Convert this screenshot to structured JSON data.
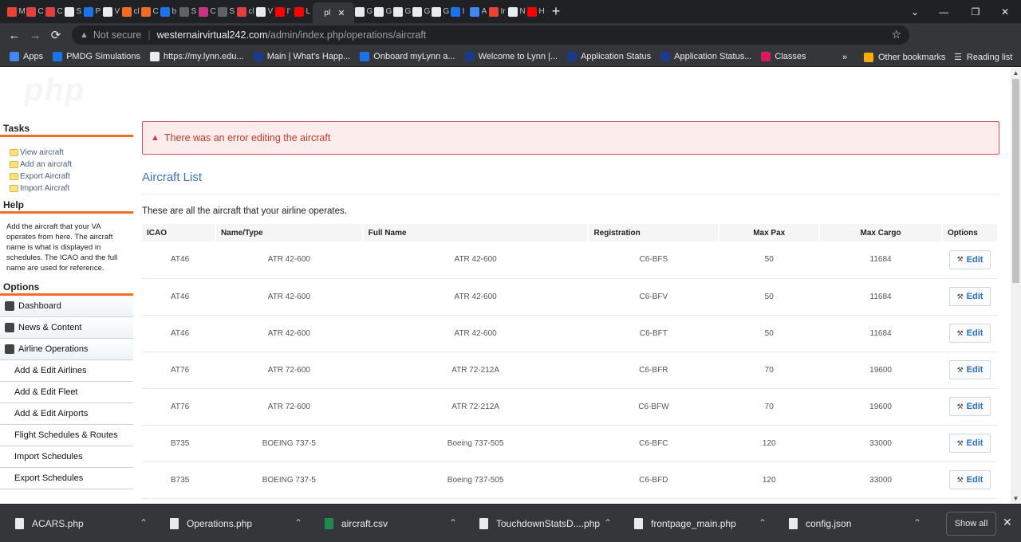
{
  "browser": {
    "tabs": [
      {
        "label": "M Ir",
        "color": "#ea4335"
      },
      {
        "label": "C",
        "color": "#e04040"
      },
      {
        "label": "C",
        "color": "#e04040"
      },
      {
        "label": "S",
        "color": "#e8eaed"
      },
      {
        "label": "P",
        "color": "#1a73e8"
      },
      {
        "label": "V",
        "color": "#e8eaed"
      },
      {
        "label": "cl",
        "color": "#f26c23"
      },
      {
        "label": "C",
        "color": "#f26c23"
      },
      {
        "label": "b",
        "color": "#1a73e8"
      },
      {
        "label": "S",
        "color": "#5f6368"
      },
      {
        "label": "C",
        "color": "#c13584"
      },
      {
        "label": "S",
        "color": "#5f6368"
      },
      {
        "label": "cl",
        "color": "#e04040"
      },
      {
        "label": "V",
        "color": "#e8eaed"
      },
      {
        "label": "I'",
        "color": "#ff0000"
      },
      {
        "label": "L",
        "color": "#ff0000"
      },
      {
        "label": "pl",
        "color": "#35363a",
        "active": true
      },
      {
        "label": "G",
        "color": "#e8eaed"
      },
      {
        "label": "G",
        "color": "#e8eaed"
      },
      {
        "label": "G",
        "color": "#e8eaed"
      },
      {
        "label": "G",
        "color": "#e8eaed"
      },
      {
        "label": "G",
        "color": "#e8eaed"
      },
      {
        "label": "I",
        "color": "#1a73e8"
      },
      {
        "label": "A",
        "color": "#4285f4"
      },
      {
        "label": "Ir",
        "color": "#ea4335"
      },
      {
        "label": "N",
        "color": "#e8eaed"
      },
      {
        "label": "H",
        "color": "#ff0000"
      }
    ],
    "address": {
      "security_label": "Not secure",
      "host": "westernairvirtual242.com",
      "path": "/admin/index.php/operations/aircraft"
    },
    "bookmarks": [
      {
        "label": "Apps",
        "color": "#4285f4"
      },
      {
        "label": "PMDG Simulations",
        "color": "#1a73e8"
      },
      {
        "label": "https://my.lynn.edu...",
        "color": "#e8eaed"
      },
      {
        "label": "Main | What's Happ...",
        "color": "#1a3a8a"
      },
      {
        "label": "Onboard myLynn a...",
        "color": "#1a73e8"
      },
      {
        "label": "Welcome to Lynn |...",
        "color": "#1a3a8a"
      },
      {
        "label": "Application Status",
        "color": "#1a3a8a"
      },
      {
        "label": "Application Status...",
        "color": "#1a3a8a"
      },
      {
        "label": "Classes",
        "color": "#d81b60"
      }
    ],
    "bookmarks_overflow": "»",
    "other_bookmarks": "Other bookmarks",
    "reading_list": "Reading list"
  },
  "sidebar": {
    "tasks_heading": "Tasks",
    "tasks": [
      "View aircraft",
      "Add an aircraft",
      "Export Aircraft",
      "Import Aircraft"
    ],
    "help_heading": "Help",
    "help_text": "Add the aircraft that your VA operates from here. The aircraft name is what is displayed in schedules. The ICAO and the full name are used for reference.",
    "options_heading": "Options",
    "options": [
      "Dashboard",
      "News & Content",
      "Airline Operations"
    ],
    "sub_options": [
      "Add & Edit Airlines",
      "Add & Edit Fleet",
      "Add & Edit Airports",
      "Flight Schedules & Routes",
      "Import Schedules",
      "Export Schedules"
    ]
  },
  "main": {
    "error_message": "There was an error editing the aircraft",
    "title": "Aircraft List",
    "intro": "These are all the aircraft that your airline operates.",
    "columns": [
      "ICAO",
      "Name/Type",
      "Full Name",
      "Registration",
      "Max Pax",
      "Max Cargo",
      "Options"
    ],
    "edit_label": "Edit",
    "rows": [
      {
        "icao": "AT46",
        "name": "ATR 42-600",
        "full_name": "ATR 42-600",
        "registration": "C6-BFS",
        "max_pax": "50",
        "max_cargo": "11684"
      },
      {
        "icao": "AT46",
        "name": "ATR 42-600",
        "full_name": "ATR 42-600",
        "registration": "C6-BFV",
        "max_pax": "50",
        "max_cargo": "11684"
      },
      {
        "icao": "AT46",
        "name": "ATR 42-600",
        "full_name": "ATR 42-600",
        "registration": "C6-BFT",
        "max_pax": "50",
        "max_cargo": "11684"
      },
      {
        "icao": "AT76",
        "name": "ATR 72-600",
        "full_name": "ATR 72-212A",
        "registration": "C6-BFR",
        "max_pax": "70",
        "max_cargo": "19600"
      },
      {
        "icao": "AT76",
        "name": "ATR 72-600",
        "full_name": "ATR 72-212A",
        "registration": "C6-BFW",
        "max_pax": "70",
        "max_cargo": "19600"
      },
      {
        "icao": "B735",
        "name": "BOEING 737-5",
        "full_name": "Boeing 737-505",
        "registration": "C6-BFC",
        "max_pax": "120",
        "max_cargo": "33000"
      },
      {
        "icao": "B735",
        "name": "BOEING 737-5",
        "full_name": "Boeing 737-505",
        "registration": "C6-BFD",
        "max_pax": "120",
        "max_cargo": "33000"
      }
    ]
  },
  "downloads": {
    "items": [
      {
        "name": "ACARS.php",
        "type": "doc"
      },
      {
        "name": "Operations.php",
        "type": "doc"
      },
      {
        "name": "aircraft.csv",
        "type": "xl"
      },
      {
        "name": "TouchdownStatsD....php",
        "type": "doc"
      },
      {
        "name": "frontpage_main.php",
        "type": "doc"
      },
      {
        "name": "config.json",
        "type": "doc"
      }
    ],
    "show_all": "Show all"
  }
}
